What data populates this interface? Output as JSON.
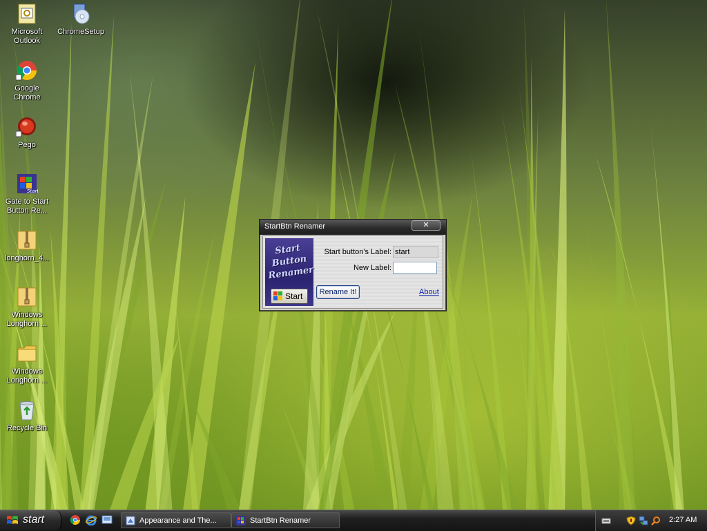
{
  "desktop": {
    "icons": [
      {
        "label": "Microsoft Outlook",
        "icon": "outlook-icon"
      },
      {
        "label": "ChromeSetup",
        "icon": "installer-cd-icon"
      },
      {
        "label": "Google Chrome",
        "icon": "chrome-icon"
      },
      {
        "label": "Pego",
        "icon": "pego-icon"
      },
      {
        "label": "Gate to Start Button Re...",
        "icon": "start-button-renamer-icon"
      },
      {
        "label": "longhorn_4...",
        "icon": "zip-folder-icon"
      },
      {
        "label": "Windows Longhorn ...",
        "icon": "zip-folder-icon"
      },
      {
        "label": "Windows Longhorn ...",
        "icon": "folder-icon"
      },
      {
        "label": "Recycle Bin",
        "icon": "recycle-bin-icon"
      }
    ]
  },
  "dialog": {
    "title": "StartBtn Renamer",
    "close_label": "✕",
    "logo_text": "Start Button Renamer",
    "logo_button_label": "Start",
    "current_label_caption": "Start button's Label:",
    "current_label_value": "start",
    "new_label_caption": "New Label:",
    "new_label_value": "",
    "rename_button": "Rename It!",
    "about_link": "About"
  },
  "taskbar": {
    "start_label": "start",
    "quick_launch": [
      "chrome-icon",
      "internet-explorer-icon",
      "show-desktop-icon"
    ],
    "buttons": [
      {
        "label": "Appearance and The...",
        "icon": "control-panel-icon"
      },
      {
        "label": "StartBtn Renamer",
        "icon": "start-button-renamer-icon"
      }
    ],
    "tray_icons": [
      "keyboard-icon",
      "security-shield-icon",
      "network-icon",
      "search-icon"
    ],
    "clock": "2:27 AM"
  }
}
